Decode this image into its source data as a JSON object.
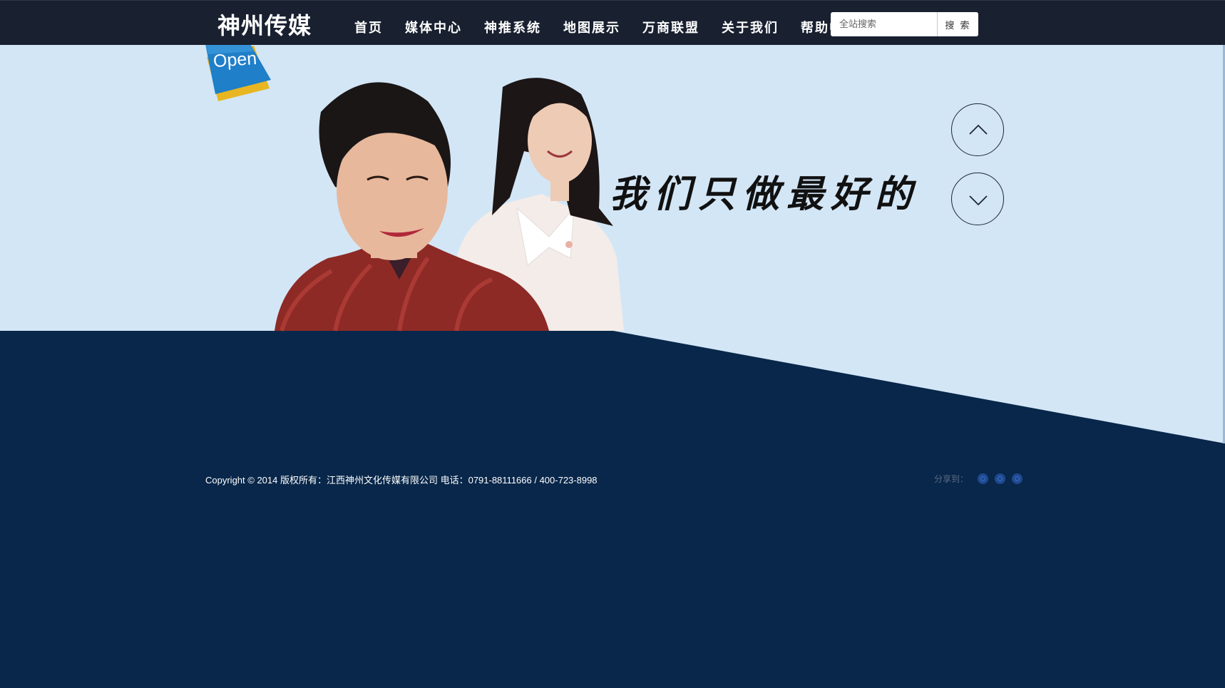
{
  "header": {
    "logo": "神州传媒",
    "nav": [
      "首页",
      "媒体中心",
      "神推系统",
      "地图展示",
      "万商联盟",
      "关于我们",
      "帮助中心"
    ],
    "search": {
      "placeholder": "全站搜索",
      "button": "搜 索"
    }
  },
  "banner": {
    "badge": "Open",
    "slogan": "我们只做最好的",
    "prev_icon": "chevron-up-icon",
    "next_icon": "chevron-down-icon",
    "images": [
      "woman-red-qipao-photo",
      "woman-white-blouse-photo"
    ]
  },
  "footer": {
    "copyright": "Copyright © 2014 版权所有：江西神州文化传媒有限公司 电话：0791-88111666 / 400-723-8998",
    "share_label": "分享到：",
    "share_icons": [
      "share-weibo-icon",
      "share-tencent-icon",
      "share-qzone-icon"
    ]
  },
  "colors": {
    "nav_bg": "#192030",
    "banner_bg": "#d3e6f6",
    "footer_bg": "#08274a",
    "badge_blue": "#1f7fc9",
    "badge_yellow": "#e8b620"
  }
}
